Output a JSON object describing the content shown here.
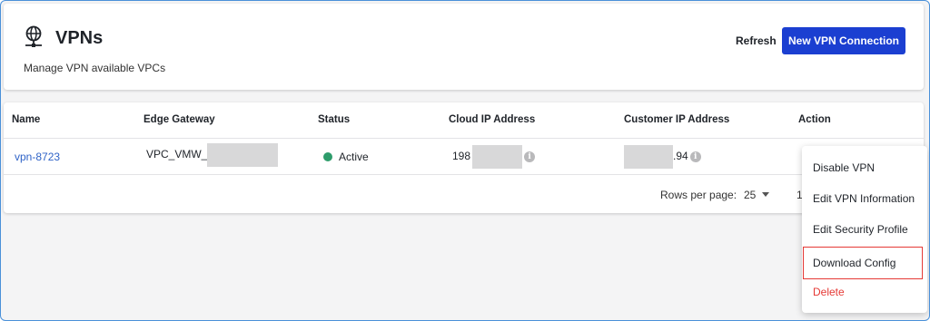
{
  "header": {
    "title": "VPNs",
    "subtitle": "Manage VPN available VPCs",
    "refresh_label": "Refresh",
    "new_button_label": "New VPN Connection",
    "icon": "network-globe-icon"
  },
  "table": {
    "columns": [
      "Name",
      "Edge Gateway",
      "Status",
      "Cloud IP Address",
      "Customer IP Address",
      "Action"
    ],
    "rows": [
      {
        "name": "vpn-8723",
        "edge_gateway": "VPC_VMW_",
        "status": "Active",
        "cloud_ip": "198",
        "customer_ip": ".94"
      }
    ],
    "rows_per_page_label": "Rows per page:",
    "rows_per_page_value": "25",
    "page_indicator": "1"
  },
  "action_menu": {
    "items": [
      "Disable VPN",
      "Edit VPN Information",
      "Edit Security Profile",
      "Download Config",
      "Delete"
    ]
  },
  "colors": {
    "primary": "#1b3fd1",
    "link": "#2f63c7",
    "active": "#2e9c6b",
    "danger": "#e53935"
  }
}
